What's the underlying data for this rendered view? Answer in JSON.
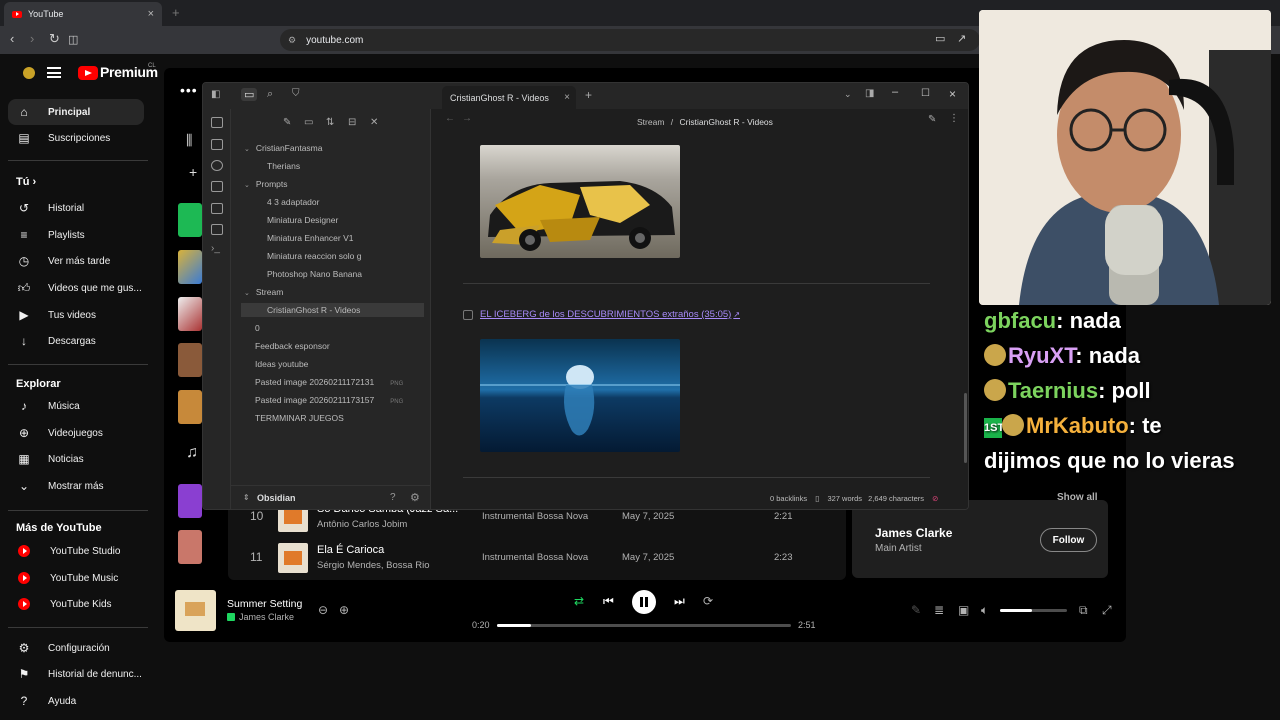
{
  "browser": {
    "tab_title": "YouTube",
    "url": "youtube.com"
  },
  "youtube": {
    "logo": "Premium",
    "country": "CL",
    "nav": [
      {
        "label": "Principal",
        "icon": "home-icon"
      },
      {
        "label": "Suscripciones",
        "icon": "subscriptions-icon"
      }
    ],
    "you_header": "Tú",
    "you_items": [
      {
        "label": "Historial",
        "icon": "history-icon"
      },
      {
        "label": "Playlists",
        "icon": "playlists-icon"
      },
      {
        "label": "Ver más tarde",
        "icon": "clock-icon"
      },
      {
        "label": "Videos que me gus...",
        "icon": "thumbs-up-icon"
      },
      {
        "label": "Tus videos",
        "icon": "video-icon"
      },
      {
        "label": "Descargas",
        "icon": "download-icon"
      }
    ],
    "explore_header": "Explorar",
    "explore_items": [
      {
        "label": "Música",
        "icon": "music-icon"
      },
      {
        "label": "Videojuegos",
        "icon": "gamepad-icon"
      },
      {
        "label": "Noticias",
        "icon": "news-icon"
      },
      {
        "label": "Mostrar más",
        "icon": "chevron-down-icon"
      }
    ],
    "more_header": "Más de YouTube",
    "more_items": [
      "YouTube Studio",
      "YouTube Music",
      "YouTube Kids"
    ],
    "footer_items": [
      {
        "label": "Configuración",
        "icon": "gear-icon"
      },
      {
        "label": "Historial de denunc...",
        "icon": "flag-icon"
      },
      {
        "label": "Ayuda",
        "icon": "help-icon"
      }
    ]
  },
  "music_app": {
    "tracks": [
      {
        "num": "10",
        "title": "So Danco Samba (Jazz Sa...",
        "artist": "Antônio Carlos Jobim",
        "album": "Instrumental Bossa Nova",
        "date": "May 7, 2025",
        "duration": "2:21"
      },
      {
        "num": "11",
        "title": "Ela É Carioca",
        "artist": "Sérgio Mendes, Bossa Rio",
        "album": "Instrumental Bossa Nova",
        "date": "May 7, 2025",
        "duration": "2:23"
      }
    ],
    "show_all": "Show all",
    "artist": {
      "name": "James Clarke",
      "role": "Main Artist",
      "follow": "Follow"
    },
    "player": {
      "title": "Summer Setting",
      "artist": "James Clarke",
      "elapsed": "0:20",
      "total": "2:51",
      "progress": 0.117,
      "volume": 0.48
    }
  },
  "obsidian": {
    "tab_title": "CristianGhost R - Videos",
    "breadcrumb_parent": "Stream",
    "breadcrumb_sep": "/",
    "breadcrumb_current": "CristianGhost R - Videos",
    "tree": [
      {
        "label": "CristianFantasma",
        "type": "folder",
        "level": 0
      },
      {
        "label": "Therians",
        "type": "file",
        "level": 1
      },
      {
        "label": "Prompts",
        "type": "folder",
        "level": 0
      },
      {
        "label": "4 3 adaptador",
        "type": "file",
        "level": 1
      },
      {
        "label": "Miniatura Designer",
        "type": "file",
        "level": 1
      },
      {
        "label": "Miniatura Enhancer V1",
        "type": "file",
        "level": 1
      },
      {
        "label": "Miniatura reaccion solo g",
        "type": "file",
        "level": 1
      },
      {
        "label": "Photoshop Nano Banana",
        "type": "file",
        "level": 1
      },
      {
        "label": "Stream",
        "type": "folder",
        "level": 0
      },
      {
        "label": "CristianGhost R - Videos",
        "type": "file",
        "level": 1,
        "selected": true
      },
      {
        "label": "0",
        "type": "file",
        "level": 0
      },
      {
        "label": "Feedback esponsor",
        "type": "file",
        "level": 0
      },
      {
        "label": "Ideas youtube",
        "type": "file",
        "level": 0
      },
      {
        "label": "Pasted image 20260211172131",
        "type": "file",
        "level": 0,
        "ext": "PNG"
      },
      {
        "label": "Pasted image 20260211173157",
        "type": "file",
        "level": 0,
        "ext": "PNG"
      },
      {
        "label": "TERMMINAR JUEGOS",
        "type": "file",
        "level": 0
      }
    ],
    "vault_name": "Obsidian",
    "link_text": "EL ICEBERG de los DESCUBRIMIENTOS extraños (35:05)",
    "status": {
      "backlinks": "0 backlinks",
      "words": "327 words",
      "chars": "2,649 characters"
    }
  },
  "chat": [
    {
      "user": "gbfacu",
      "message": ": nada"
    },
    {
      "user": "RyuXT",
      "message": ": nada"
    },
    {
      "user": "Taernius",
      "message": ": poll"
    },
    {
      "user": "MrKabuto",
      "message": ": te",
      "badge": "1ST"
    },
    {
      "user": "",
      "message": "dijimos que no lo vieras"
    }
  ],
  "colors": {
    "accent_purple": "#a88bfa",
    "spotify_green": "#1ed760",
    "youtube_red": "#ff0000"
  }
}
